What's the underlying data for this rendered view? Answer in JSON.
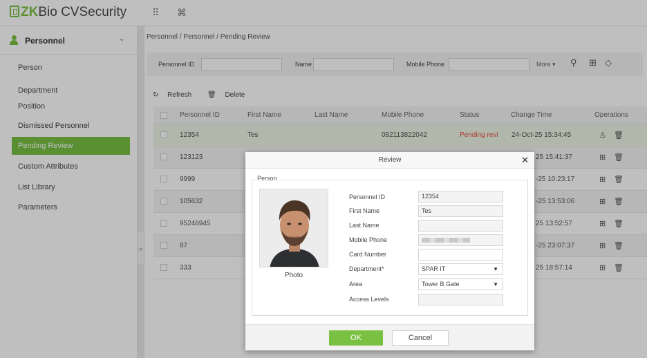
{
  "app": {
    "brand_zk": "ZK",
    "brand_rest": "Bio CVSecurity",
    "menu_icon": "grid-icon",
    "module_icon": "command-icon"
  },
  "colors": {
    "accent": "#7ac143",
    "pending": "#e64b3c"
  },
  "sidebar": {
    "title": "Personnel",
    "items": [
      {
        "label": "Person"
      },
      {
        "label": "Department"
      },
      {
        "label": "Position"
      },
      {
        "label": "Dismissed Personnel"
      },
      {
        "label": "Pending Review"
      },
      {
        "label": "Custom Attributes"
      },
      {
        "label": "List Library"
      },
      {
        "label": "Parameters"
      }
    ],
    "collapse_glyph": "«"
  },
  "breadcrumb": "Personnel / Personnel / Pending Review",
  "filters": {
    "personnel_id_label": "Personnel ID",
    "name_label": "Name",
    "mobile_label": "Mobile Phone",
    "more_label": "More ▾"
  },
  "toolbar": {
    "refresh": "Refresh",
    "delete": "Delete"
  },
  "table": {
    "headers": [
      "Personnel ID",
      "First Name",
      "Last Name",
      "Mobile Phone",
      "Status",
      "Change Time",
      "Operations"
    ],
    "rows": [
      {
        "id": "12354",
        "first": "Tes",
        "last": "",
        "mobile": "082113822042",
        "status": "Pending revi",
        "time": "24-Oct-25 15:34:45"
      },
      {
        "id": "123123",
        "first": "",
        "last": "",
        "mobile": "",
        "status": "",
        "time": "25 15:41:37"
      },
      {
        "id": "9999",
        "first": "",
        "last": "",
        "mobile": "",
        "status": "",
        "time": "-25 10:23:17"
      },
      {
        "id": "105632",
        "first": "",
        "last": "",
        "mobile": "",
        "status": "",
        "time": "-25 13:53:06"
      },
      {
        "id": "95246945",
        "first": "",
        "last": "",
        "mobile": "",
        "status": "",
        "time": "25 13:52:57"
      },
      {
        "id": "87",
        "first": "",
        "last": "",
        "mobile": "",
        "status": "",
        "time": "-25 23:07:37"
      },
      {
        "id": "333",
        "first": "",
        "last": "",
        "mobile": "",
        "status": "",
        "time": "25 18:57:14"
      }
    ]
  },
  "modal": {
    "title": "Review",
    "legend": "Person",
    "photo_label": "Photo",
    "fields": {
      "personnel_id_label": "Personnel ID",
      "personnel_id_value": "12354",
      "first_name_label": "First Name",
      "first_name_value": "Tes",
      "last_name_label": "Last Name",
      "last_name_value": "",
      "mobile_label": "Mobile Phone",
      "card_label": "Card Number",
      "card_value": "",
      "department_label": "Department*",
      "department_value": "SPAR IT",
      "area_label": "Area",
      "area_value": "Tower B Gate",
      "access_label": "Access Levels",
      "access_value": ""
    },
    "ok_label": "OK",
    "cancel_label": "Cancel"
  }
}
